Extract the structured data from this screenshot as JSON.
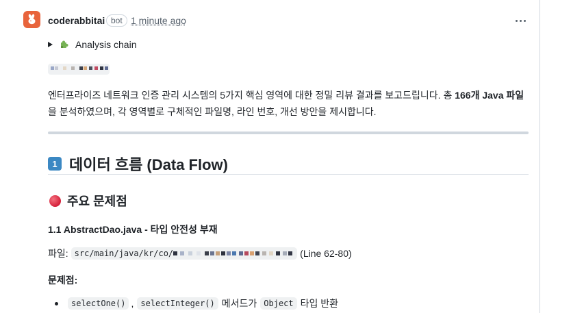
{
  "comment": {
    "author": "coderabbitai",
    "badge": "bot",
    "timestamp": "1 minute ago",
    "avatar_icon": "rabbit-icon",
    "menu_icon": "kebab-menu-icon",
    "accent_color": "#e8643c"
  },
  "details": {
    "icon": "puzzle-piece-icon",
    "label": "Analysis chain"
  },
  "intro": {
    "part1": "엔터프라이즈 네트워크 인증 관리 시스템의 5가지 핵심 영역에 대한 정밀 리뷰 결과를 보고드립니다. 총 ",
    "bold": "166개 Java 파일",
    "part2": "을 분석하였으며, 각 영역별로 구체적인 파일명, 라인 번호, 개선 방안을 제시합니다."
  },
  "section1": {
    "keycap": "1",
    "title": "데이터 흐름 (Data Flow)"
  },
  "subsection": {
    "icon": "red-circle-icon",
    "title": "주요 문제점"
  },
  "issue": {
    "title": "1.1 AbstractDao.java - 타입 안전성 부재",
    "file_label": "파일:",
    "file_path": "src/main/java/kr/co/",
    "line_ref": "(Line 62-80)",
    "problem_label": "문제점:",
    "bullet": {
      "code1": "selectOne()",
      "separator": ",",
      "code2": "selectInteger()",
      "text1": "메서드가",
      "code3": "Object",
      "text2": "타입 반환"
    }
  }
}
